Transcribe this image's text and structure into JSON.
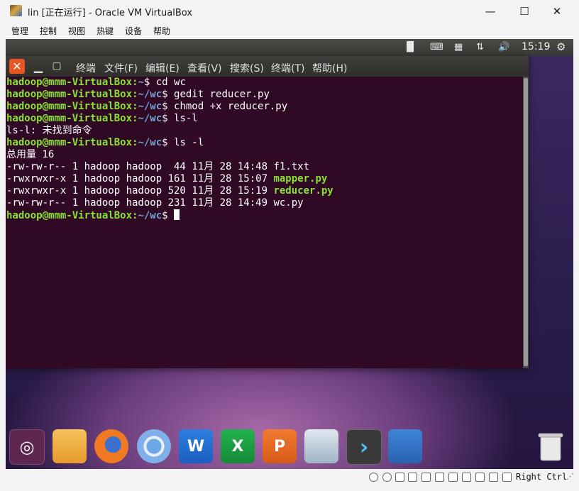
{
  "window": {
    "title": "lin [正在运行] - Oracle VM VirtualBox",
    "min_glyph": "—",
    "max_glyph": "☐",
    "close_glyph": "✕"
  },
  "menubar": [
    "管理",
    "控制",
    "视图",
    "热键",
    "设备",
    "帮助"
  ],
  "guest_panel": {
    "time": "15:19",
    "icons": [
      "keyboard-layout-icon",
      "keyboard-icon",
      "calendar-icon",
      "network-arrows-icon",
      "volume-icon",
      "settings-gear-icon"
    ]
  },
  "terminal": {
    "controls": {
      "close": "✕",
      "minimize": "▁",
      "maximize": "▢"
    },
    "menu": [
      "终端",
      "文件(F)",
      "编辑(E)",
      "查看(V)",
      "搜索(S)",
      "终端(T)",
      "帮助(H)"
    ],
    "prompt_user": "hadoop@mmm-VirtualBox",
    "lines": [
      {
        "type": "prompt",
        "path": "~",
        "cmd": "cd wc"
      },
      {
        "type": "prompt",
        "path": "~/wc",
        "cmd": "gedit reducer.py"
      },
      {
        "type": "prompt",
        "path": "~/wc",
        "cmd": "chmod +x reducer.py"
      },
      {
        "type": "prompt",
        "path": "~/wc",
        "cmd": "ls-l"
      },
      {
        "type": "out",
        "text": "ls-l: 未找到命令"
      },
      {
        "type": "prompt",
        "path": "~/wc",
        "cmd": "ls -l"
      },
      {
        "type": "out",
        "text": "总用量 16"
      },
      {
        "type": "file",
        "meta": "-rw-rw-r-- 1 hadoop hadoop  44 11月 28 14:48 ",
        "name": "f1.txt",
        "exec": false
      },
      {
        "type": "file",
        "meta": "-rwxrwxr-x 1 hadoop hadoop 161 11月 28 15:07 ",
        "name": "mapper.py",
        "exec": true
      },
      {
        "type": "file",
        "meta": "-rwxrwxr-x 1 hadoop hadoop 520 11月 28 15:19 ",
        "name": "reducer.py",
        "exec": true
      },
      {
        "type": "file",
        "meta": "-rw-rw-r-- 1 hadoop hadoop 231 11月 28 14:49 ",
        "name": "wc.py",
        "exec": false
      },
      {
        "type": "prompt",
        "path": "~/wc",
        "cmd": "",
        "cursor": true
      }
    ]
  },
  "dock": {
    "items": [
      {
        "name": "ubuntu-logo-icon",
        "label": "◎"
      },
      {
        "name": "files-folder-icon",
        "label": ""
      },
      {
        "name": "firefox-icon",
        "label": ""
      },
      {
        "name": "chromium-icon",
        "label": ""
      },
      {
        "name": "wps-writer-icon",
        "label": "W"
      },
      {
        "name": "wps-spreadsheet-icon",
        "label": "X"
      },
      {
        "name": "wps-presentation-icon",
        "label": "P"
      },
      {
        "name": "software-store-icon",
        "label": ""
      },
      {
        "name": "terminal-app-icon",
        "label": "›"
      },
      {
        "name": "workspace-switcher-icon",
        "label": ""
      },
      {
        "name": "trash-icon",
        "label": ""
      }
    ]
  },
  "statusbar": {
    "host_key": "Right Ctrl"
  }
}
